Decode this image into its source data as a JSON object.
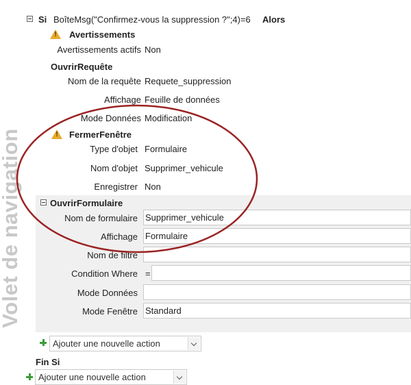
{
  "nav_pane": {
    "label": "Volet de navigation"
  },
  "if_block": {
    "keyword": "Si",
    "condition": "BoîteMsg(\"Confirmez-vous la suppression ?\";4)=6",
    "then_keyword": "Alors",
    "end_label": "Fin Si"
  },
  "warnings": {
    "title": "Avertissements",
    "active_label": "Avertissements actifs",
    "active_value": "Non"
  },
  "open_query": {
    "title": "OuvrirRequête",
    "name_label": "Nom de la requête",
    "name_value": "Requete_suppression",
    "view_label": "Affichage",
    "view_value": "Feuille de données",
    "data_mode_label": "Mode Données",
    "data_mode_value": "Modification"
  },
  "close_window": {
    "title": "FermerFenêtre",
    "object_type_label": "Type d'objet",
    "object_type_value": "Formulaire",
    "object_name_label": "Nom d'objet",
    "object_name_value": "Supprimer_vehicule",
    "save_label": "Enregistrer",
    "save_value": "Non"
  },
  "open_form": {
    "title": "OuvrirFormulaire",
    "form_name_label": "Nom de formulaire",
    "form_name_value": "Supprimer_vehicule",
    "view_label": "Affichage",
    "view_value": "Formulaire",
    "filter_label": "Nom de filtre",
    "filter_value": "",
    "where_label": "Condition Where",
    "where_prefix": "=",
    "where_value": "",
    "data_mode_label": "Mode Données",
    "data_mode_value": "",
    "window_mode_label": "Mode Fenêtre",
    "window_mode_value": "Standard"
  },
  "add_action": {
    "inner_label": "Ajouter une nouvelle action",
    "outer_label": "Ajouter une nouvelle action"
  },
  "colors": {
    "highlight_ellipse": "#9b2323",
    "warning": "#e8a92d",
    "add_icon": "#3a9c3a"
  }
}
